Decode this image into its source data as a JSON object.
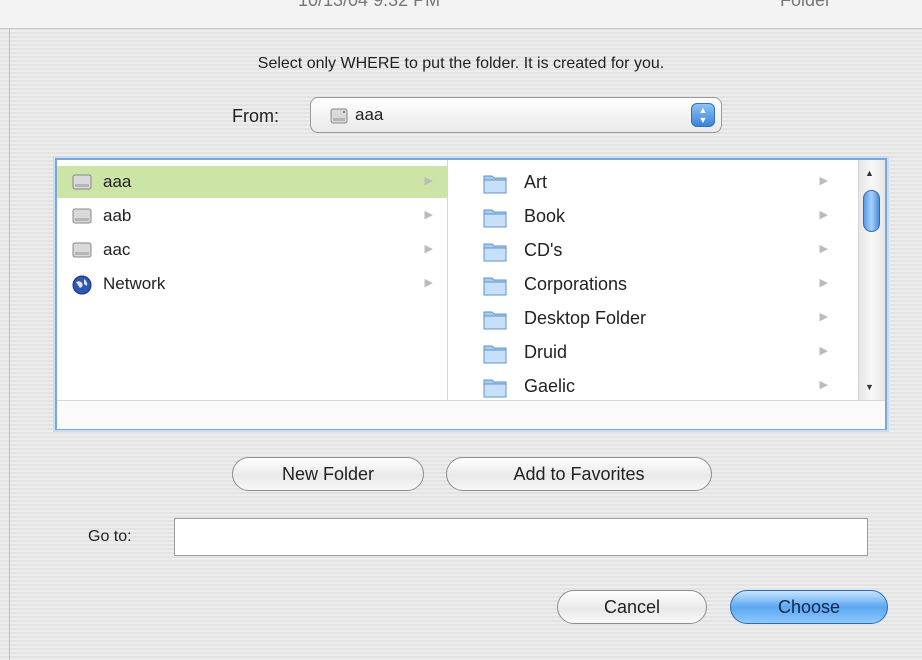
{
  "top_partial": {
    "left_text": "10/13/04 9:32 PM",
    "right_text": "Folder"
  },
  "instruction": "Select only WHERE to put the folder. It is created for you.",
  "from": {
    "label": "From:",
    "value": "aaa"
  },
  "column1": [
    {
      "name": "aaa",
      "icon": "disk-icon",
      "selected": true
    },
    {
      "name": "aab",
      "icon": "disk-icon",
      "selected": false
    },
    {
      "name": "aac",
      "icon": "disk-icon",
      "selected": false
    },
    {
      "name": "Network",
      "icon": "network-globe-icon",
      "selected": false
    }
  ],
  "column2": [
    {
      "name": "Art",
      "icon": "folder-icon"
    },
    {
      "name": "Book",
      "icon": "folder-icon"
    },
    {
      "name": "CD's",
      "icon": "folder-icon"
    },
    {
      "name": "Corporations",
      "icon": "folder-icon"
    },
    {
      "name": "Desktop Folder",
      "icon": "folder-icon"
    },
    {
      "name": "Druid",
      "icon": "folder-icon"
    },
    {
      "name": "Gaelic",
      "icon": "folder-icon"
    }
  ],
  "buttons": {
    "new_folder": "New Folder",
    "add_to_favorites": "Add to Favorites",
    "cancel": "Cancel",
    "choose": "Choose"
  },
  "goto": {
    "label": "Go to:",
    "value": ""
  },
  "colors": {
    "selection": "#cce4a5",
    "accent": "#5aa7f2",
    "border_focus": "#7aa7dc"
  }
}
